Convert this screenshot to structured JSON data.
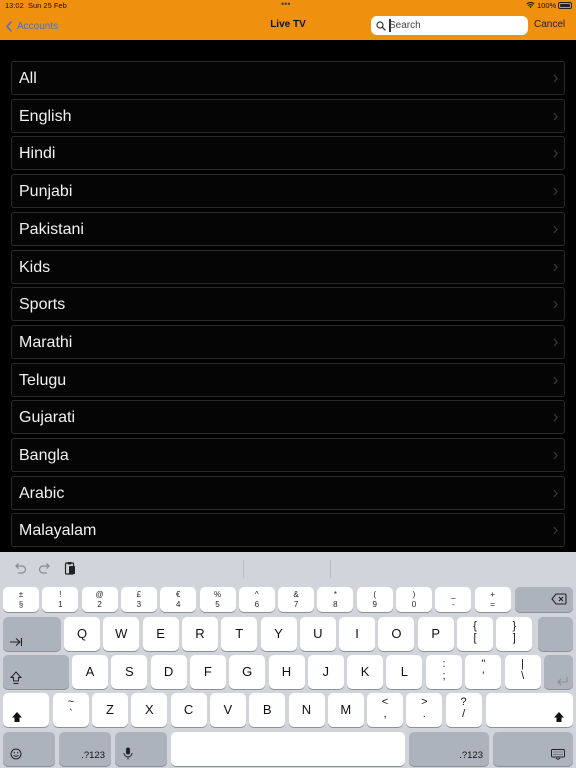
{
  "status_bar": {
    "time": "13:02",
    "date": "Sun 25 Feb",
    "dots": "•••",
    "battery": "100%"
  },
  "nav": {
    "back_label": "Accounts",
    "title": "Live TV",
    "cancel_label": "Cancel"
  },
  "search": {
    "placeholder": "Search",
    "value": ""
  },
  "categories": [
    "All",
    "English",
    "Hindi",
    "Punjabi",
    "Pakistani",
    "Kids",
    "Sports",
    "Marathi",
    "Telugu",
    "Gujarati",
    "Bangla",
    "Arabic",
    "Malayalam"
  ],
  "keyboard": {
    "number_row": [
      {
        "top": "±",
        "bot": "§"
      },
      {
        "top": "!",
        "bot": "1"
      },
      {
        "top": "@",
        "bot": "2"
      },
      {
        "top": "£",
        "bot": "3"
      },
      {
        "top": "€",
        "bot": "4"
      },
      {
        "top": "%",
        "bot": "5"
      },
      {
        "top": "^",
        "bot": "6"
      },
      {
        "top": "&",
        "bot": "7"
      },
      {
        "top": "*",
        "bot": "8"
      },
      {
        "top": "(",
        "bot": "9"
      },
      {
        "top": ")",
        "bot": "0"
      },
      {
        "top": "_",
        "bot": "-"
      },
      {
        "top": "+",
        "bot": "="
      }
    ],
    "row_q": [
      "Q",
      "W",
      "E",
      "R",
      "T",
      "Y",
      "U",
      "I",
      "O",
      "P"
    ],
    "row_q_pair": [
      {
        "top": "{",
        "bot": "["
      },
      {
        "top": "}",
        "bot": "]"
      }
    ],
    "row_a": [
      "A",
      "S",
      "D",
      "F",
      "G",
      "H",
      "J",
      "K",
      "L"
    ],
    "row_a_pair": [
      {
        "top": ":",
        "bot": ";"
      },
      {
        "top": "\"",
        "bot": "'"
      },
      {
        "top": "|",
        "bot": "\\"
      }
    ],
    "row_z_first": {
      "top": "~",
      "bot": "`"
    },
    "row_z": [
      "Z",
      "X",
      "C",
      "V",
      "B",
      "N",
      "M"
    ],
    "row_z_pair": [
      {
        "top": "<",
        "bot": ","
      },
      {
        "top": ">",
        "bot": "."
      },
      {
        "top": "?",
        "bot": "/"
      }
    ],
    "numbers_key": ".?123",
    "numbers_key_right": ".?123"
  },
  "colors": {
    "header": "#f0900f",
    "back_link": "#4a6fd0",
    "list_bg": "#000000",
    "row_bg": "#050505",
    "keyboard_bg": "#d1d4da"
  }
}
